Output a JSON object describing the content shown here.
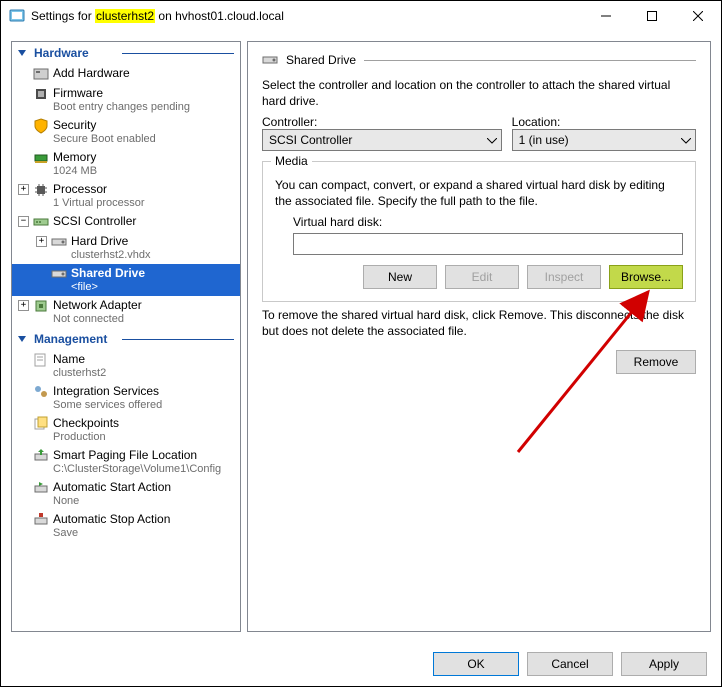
{
  "title": {
    "prefix": "Settings for",
    "vm": "clusterhst2",
    "on": "on",
    "host": "hvhost01.cloud.local"
  },
  "sections": {
    "hardware": "Hardware",
    "management": "Management"
  },
  "tree": {
    "addHardware": "Add Hardware",
    "firmware": "Firmware",
    "firmwareSub": "Boot entry changes pending",
    "security": "Security",
    "securitySub": "Secure Boot enabled",
    "memory": "Memory",
    "memorySub": "1024 MB",
    "processor": "Processor",
    "processorSub": "1 Virtual processor",
    "scsi": "SCSI Controller",
    "hardDrive": "Hard Drive",
    "hardDriveSub": "clusterhst2.vhdx",
    "sharedDrive": "Shared Drive",
    "sharedDriveSub": "<file>",
    "network": "Network Adapter",
    "networkSub": "Not connected",
    "name": "Name",
    "nameSub": "clusterhst2",
    "integration": "Integration Services",
    "integrationSub": "Some services offered",
    "checkpoints": "Checkpoints",
    "checkpointsSub": "Production",
    "smartPaging": "Smart Paging File Location",
    "smartPagingSub": "C:\\ClusterStorage\\Volume1\\Config",
    "autoStart": "Automatic Start Action",
    "autoStartSub": "None",
    "autoStop": "Automatic Stop Action",
    "autoStopSub": "Save"
  },
  "panel": {
    "heading": "Shared Drive",
    "intro": "Select the controller and location on the controller to attach the shared virtual hard drive.",
    "controllerLabel": "Controller:",
    "controllerValue": "SCSI Controller",
    "locationLabel": "Location:",
    "locationValue": "1 (in use)",
    "mediaGroup": "Media",
    "mediaText": "You can compact, convert, or expand a shared virtual hard disk by editing the associated file. Specify the full path to the file.",
    "vhdLabel": "Virtual hard disk:",
    "vhdValue": "",
    "btnNew": "New",
    "btnEdit": "Edit",
    "btnInspect": "Inspect",
    "btnBrowse": "Browse...",
    "removeText": "To remove the shared virtual hard disk, click Remove. This disconnects the disk but does not delete the associated file.",
    "btnRemove": "Remove"
  },
  "footer": {
    "ok": "OK",
    "cancel": "Cancel",
    "apply": "Apply"
  }
}
